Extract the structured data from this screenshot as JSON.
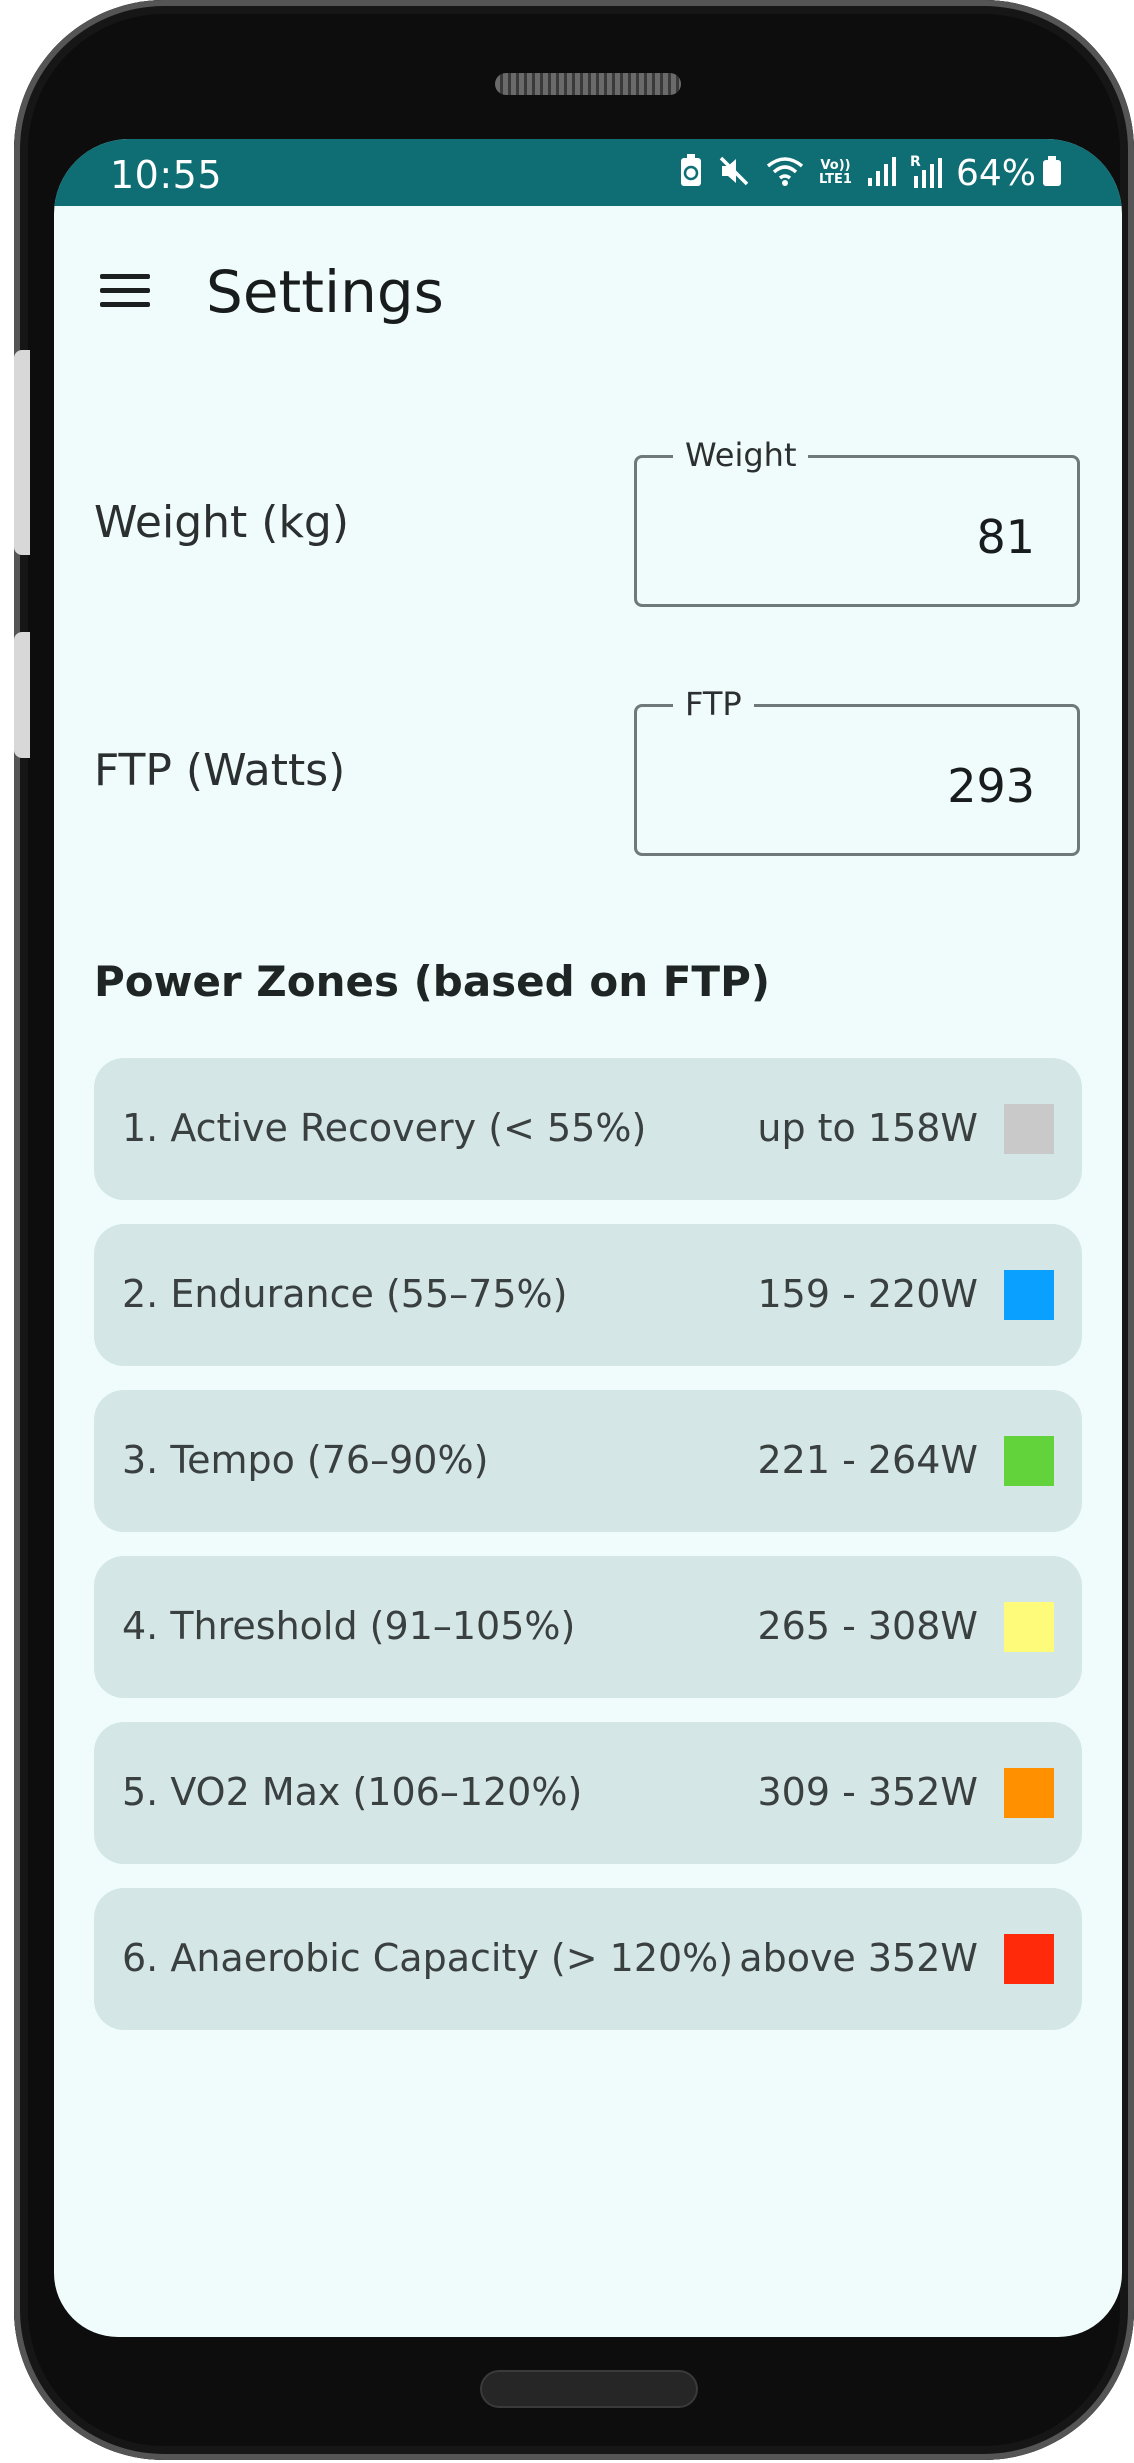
{
  "status_bar": {
    "time": "10:55",
    "battery": "64%",
    "network_label_top": "Vo))",
    "network_label_bottom": "LTE1",
    "sim_label": "R",
    "icons": [
      "battery-saver-icon",
      "mute-icon",
      "wifi-icon",
      "lte-icon",
      "signal-icon",
      "signal-roaming-icon",
      "battery-icon"
    ]
  },
  "app_bar": {
    "title": "Settings",
    "menu_icon": "hamburger-menu-icon"
  },
  "settings": {
    "weight": {
      "label": "Weight (kg)",
      "field_label": "Weight",
      "value": "81"
    },
    "ftp": {
      "label": "FTP (Watts)",
      "field_label": "FTP",
      "value": "293"
    }
  },
  "power_zones": {
    "title": "Power Zones (based on FTP)",
    "zones": [
      {
        "label": "1. Active Recovery (< 55%)",
        "range": "up to 158W",
        "color": "#c9c9c9"
      },
      {
        "label": "2. Endurance (55–75%)",
        "range": "159 - 220W",
        "color": "#0aa0ff"
      },
      {
        "label": "3. Tempo (76–90%)",
        "range": "221 - 264W",
        "color": "#63d33c"
      },
      {
        "label": "4. Threshold (91–105%)",
        "range": "265 - 308W",
        "color": "#fffb7a"
      },
      {
        "label": "5. VO2 Max (106–120%)",
        "range": "309 - 352W",
        "color": "#ff9000"
      },
      {
        "label": "6. Anaerobic Capacity (> 120%)",
        "range": "above 352W",
        "color": "#ff2a0a"
      }
    ]
  }
}
